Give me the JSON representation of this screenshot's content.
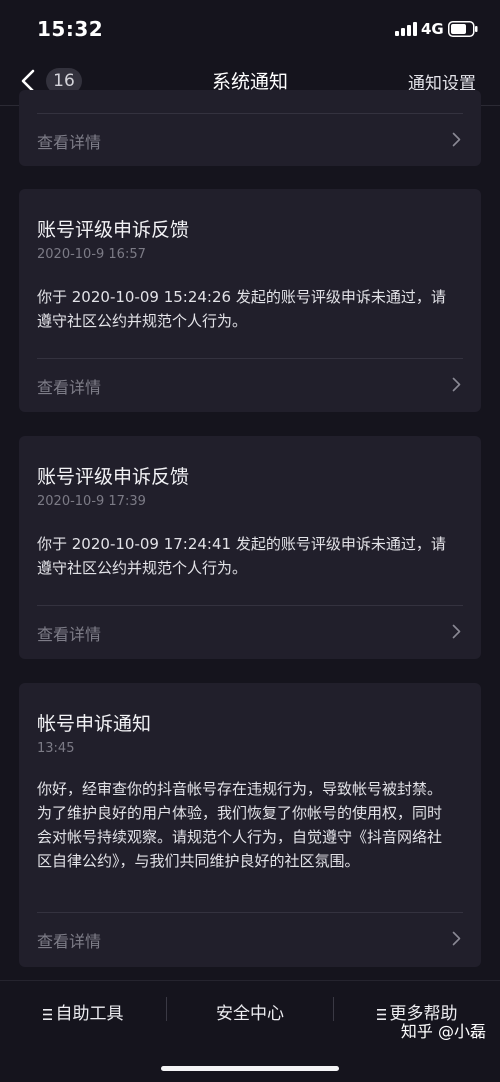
{
  "status_bar": {
    "time": "15:32",
    "network": "4G",
    "icons": [
      "signal-icon",
      "battery-icon"
    ]
  },
  "nav": {
    "back_count": "16",
    "title": "系统通知",
    "settings_label": "通知设置",
    "icons": [
      "back-chevron-icon"
    ]
  },
  "cards": [
    {
      "details_label": "查看详情"
    },
    {
      "title": "账号评级申诉反馈",
      "time": "2020-10-9 16:57",
      "body": "你于 2020-10-09 15:24:26 发起的账号评级申诉未通过，请遵守社区公约并规范个人行为。",
      "details_label": "查看详情"
    },
    {
      "title": "账号评级申诉反馈",
      "time": "2020-10-9 17:39",
      "body": "你于 2020-10-09 17:24:41 发起的账号评级申诉未通过，请遵守社区公约并规范个人行为。",
      "details_label": "查看详情"
    },
    {
      "title": "帐号申诉通知",
      "time": "13:45",
      "body": "你好，经审查你的抖音帐号存在违规行为，导致帐号被封禁。为了维护良好的用户体验，我们恢复了你帐号的使用权，同时会对帐号持续观察。请规范个人行为，自觉遵守《抖音网络社区自律公约》，与我们共同维护良好的社区氛围。",
      "details_label": "查看详情"
    }
  ],
  "bottom_tabs": [
    {
      "label": "自助工具",
      "icon": "menu-icon"
    },
    {
      "label": "安全中心"
    },
    {
      "label": "更多帮助",
      "icon": "menu-icon"
    }
  ],
  "watermark": "知乎 @小磊",
  "colors": {
    "background": "#15141d",
    "card": "#211f2b",
    "muted_text": "#7e7d88"
  }
}
